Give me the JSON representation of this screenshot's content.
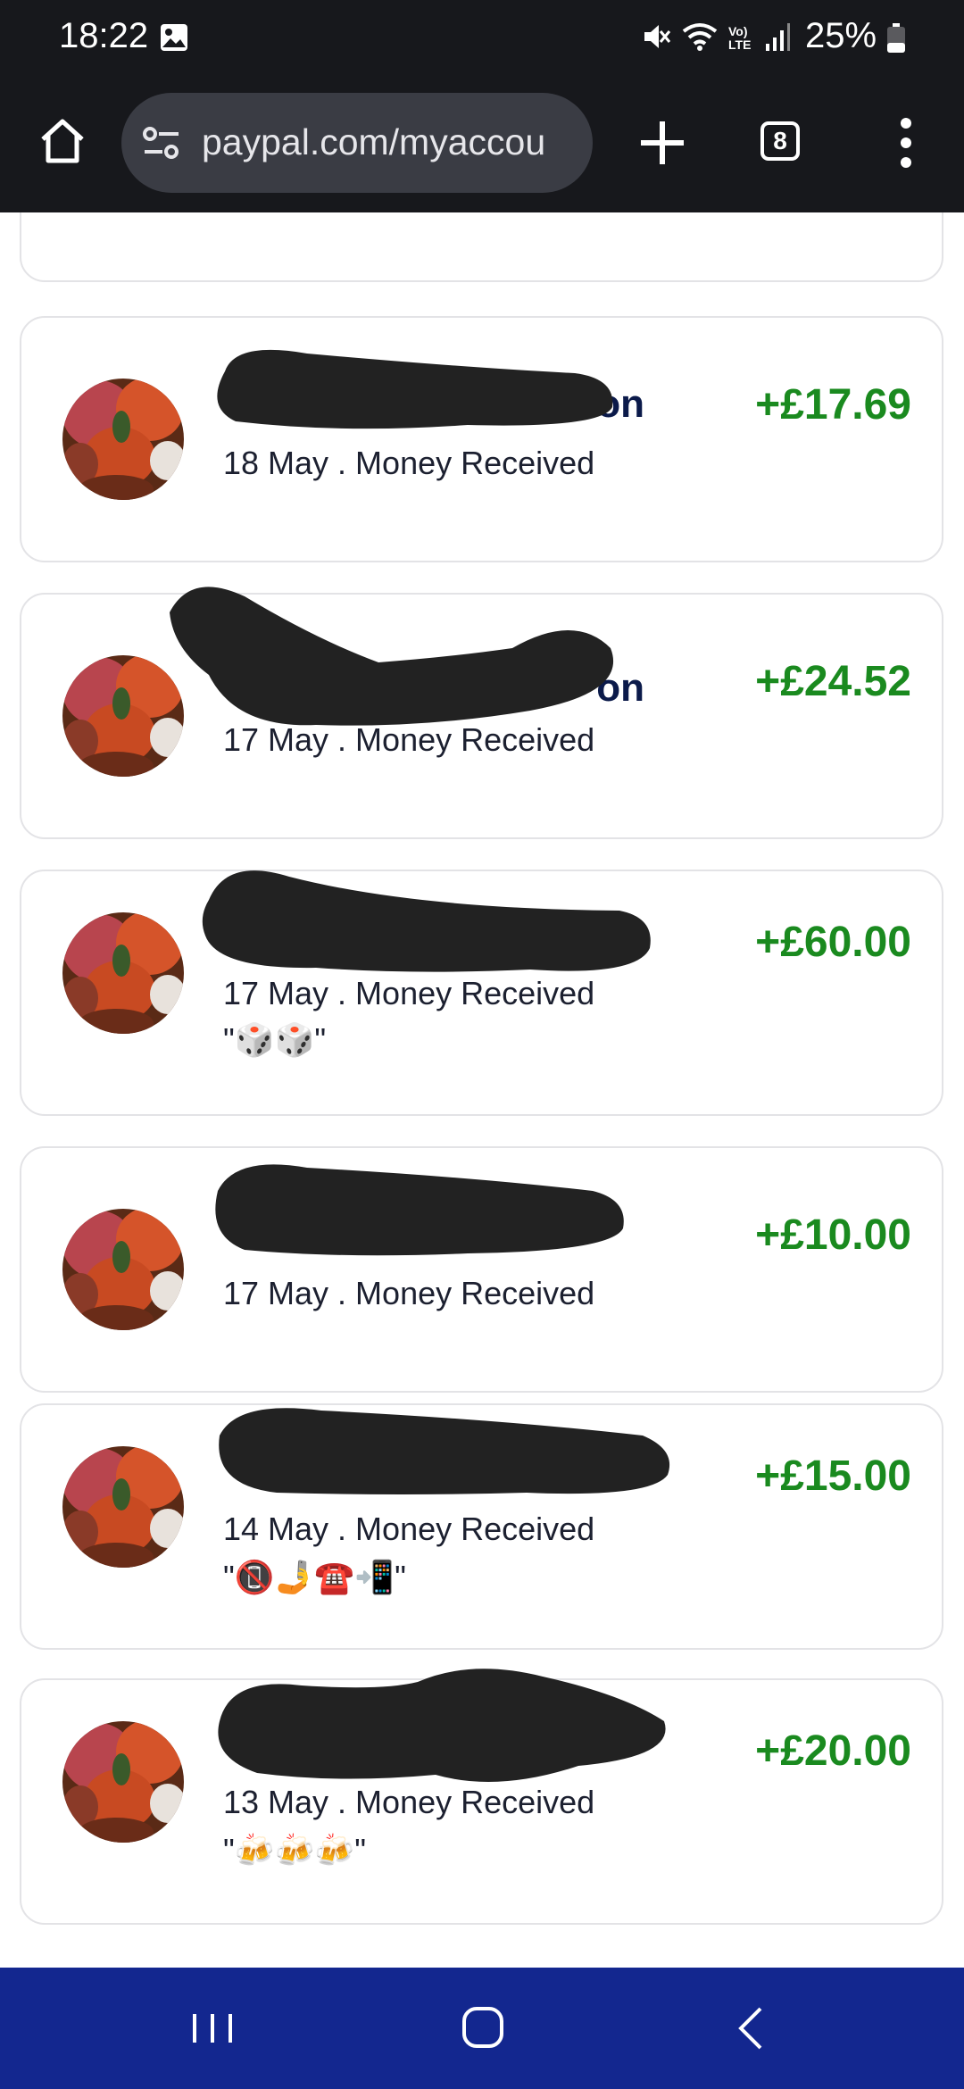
{
  "status_bar": {
    "time": "18:22",
    "battery": "25%",
    "network_label": "Vo) LTE",
    "icons": [
      "gallery-icon",
      "mute-icon",
      "wifi-icon",
      "lte-icon",
      "signal-icon",
      "battery-icon"
    ]
  },
  "browser": {
    "url": "paypal.com/myaccou",
    "tab_count": "8",
    "icons": [
      "home-icon",
      "site-settings-icon",
      "plus-icon",
      "tabs-icon",
      "more-vertical-icon"
    ]
  },
  "transactions": [
    {
      "name": "",
      "meta": "",
      "amount": "",
      "note": ""
    },
    {
      "name": "on",
      "meta": "18 May . Money Received",
      "amount": "+£17.69",
      "note": ""
    },
    {
      "name": "on",
      "meta": "17 May . Money Received",
      "amount": "+£24.52",
      "note": ""
    },
    {
      "name": "",
      "meta": "17 May . Money Received",
      "amount": "+£60.00",
      "note": "\"🎲🎲\""
    },
    {
      "name": "",
      "meta": "17 May . Money Received",
      "amount": "+£10.00",
      "note": ""
    },
    {
      "name": "",
      "meta": "14 May . Money Received",
      "amount": "+£15.00",
      "note": "\"📵🤳☎️📲\""
    },
    {
      "name": "",
      "meta": "13 May . Money Received",
      "amount": "+£20.00",
      "note": "\"🍻🍻🍻\""
    }
  ],
  "colors": {
    "amount_positive": "#1a8a1f",
    "name_text": "#0b1a4a",
    "chrome_bg": "#17181c",
    "nav_bar_bg": "#13278f"
  },
  "nav_bar": {
    "icons": [
      "recent-apps-icon",
      "home-circle-icon",
      "back-icon"
    ]
  }
}
